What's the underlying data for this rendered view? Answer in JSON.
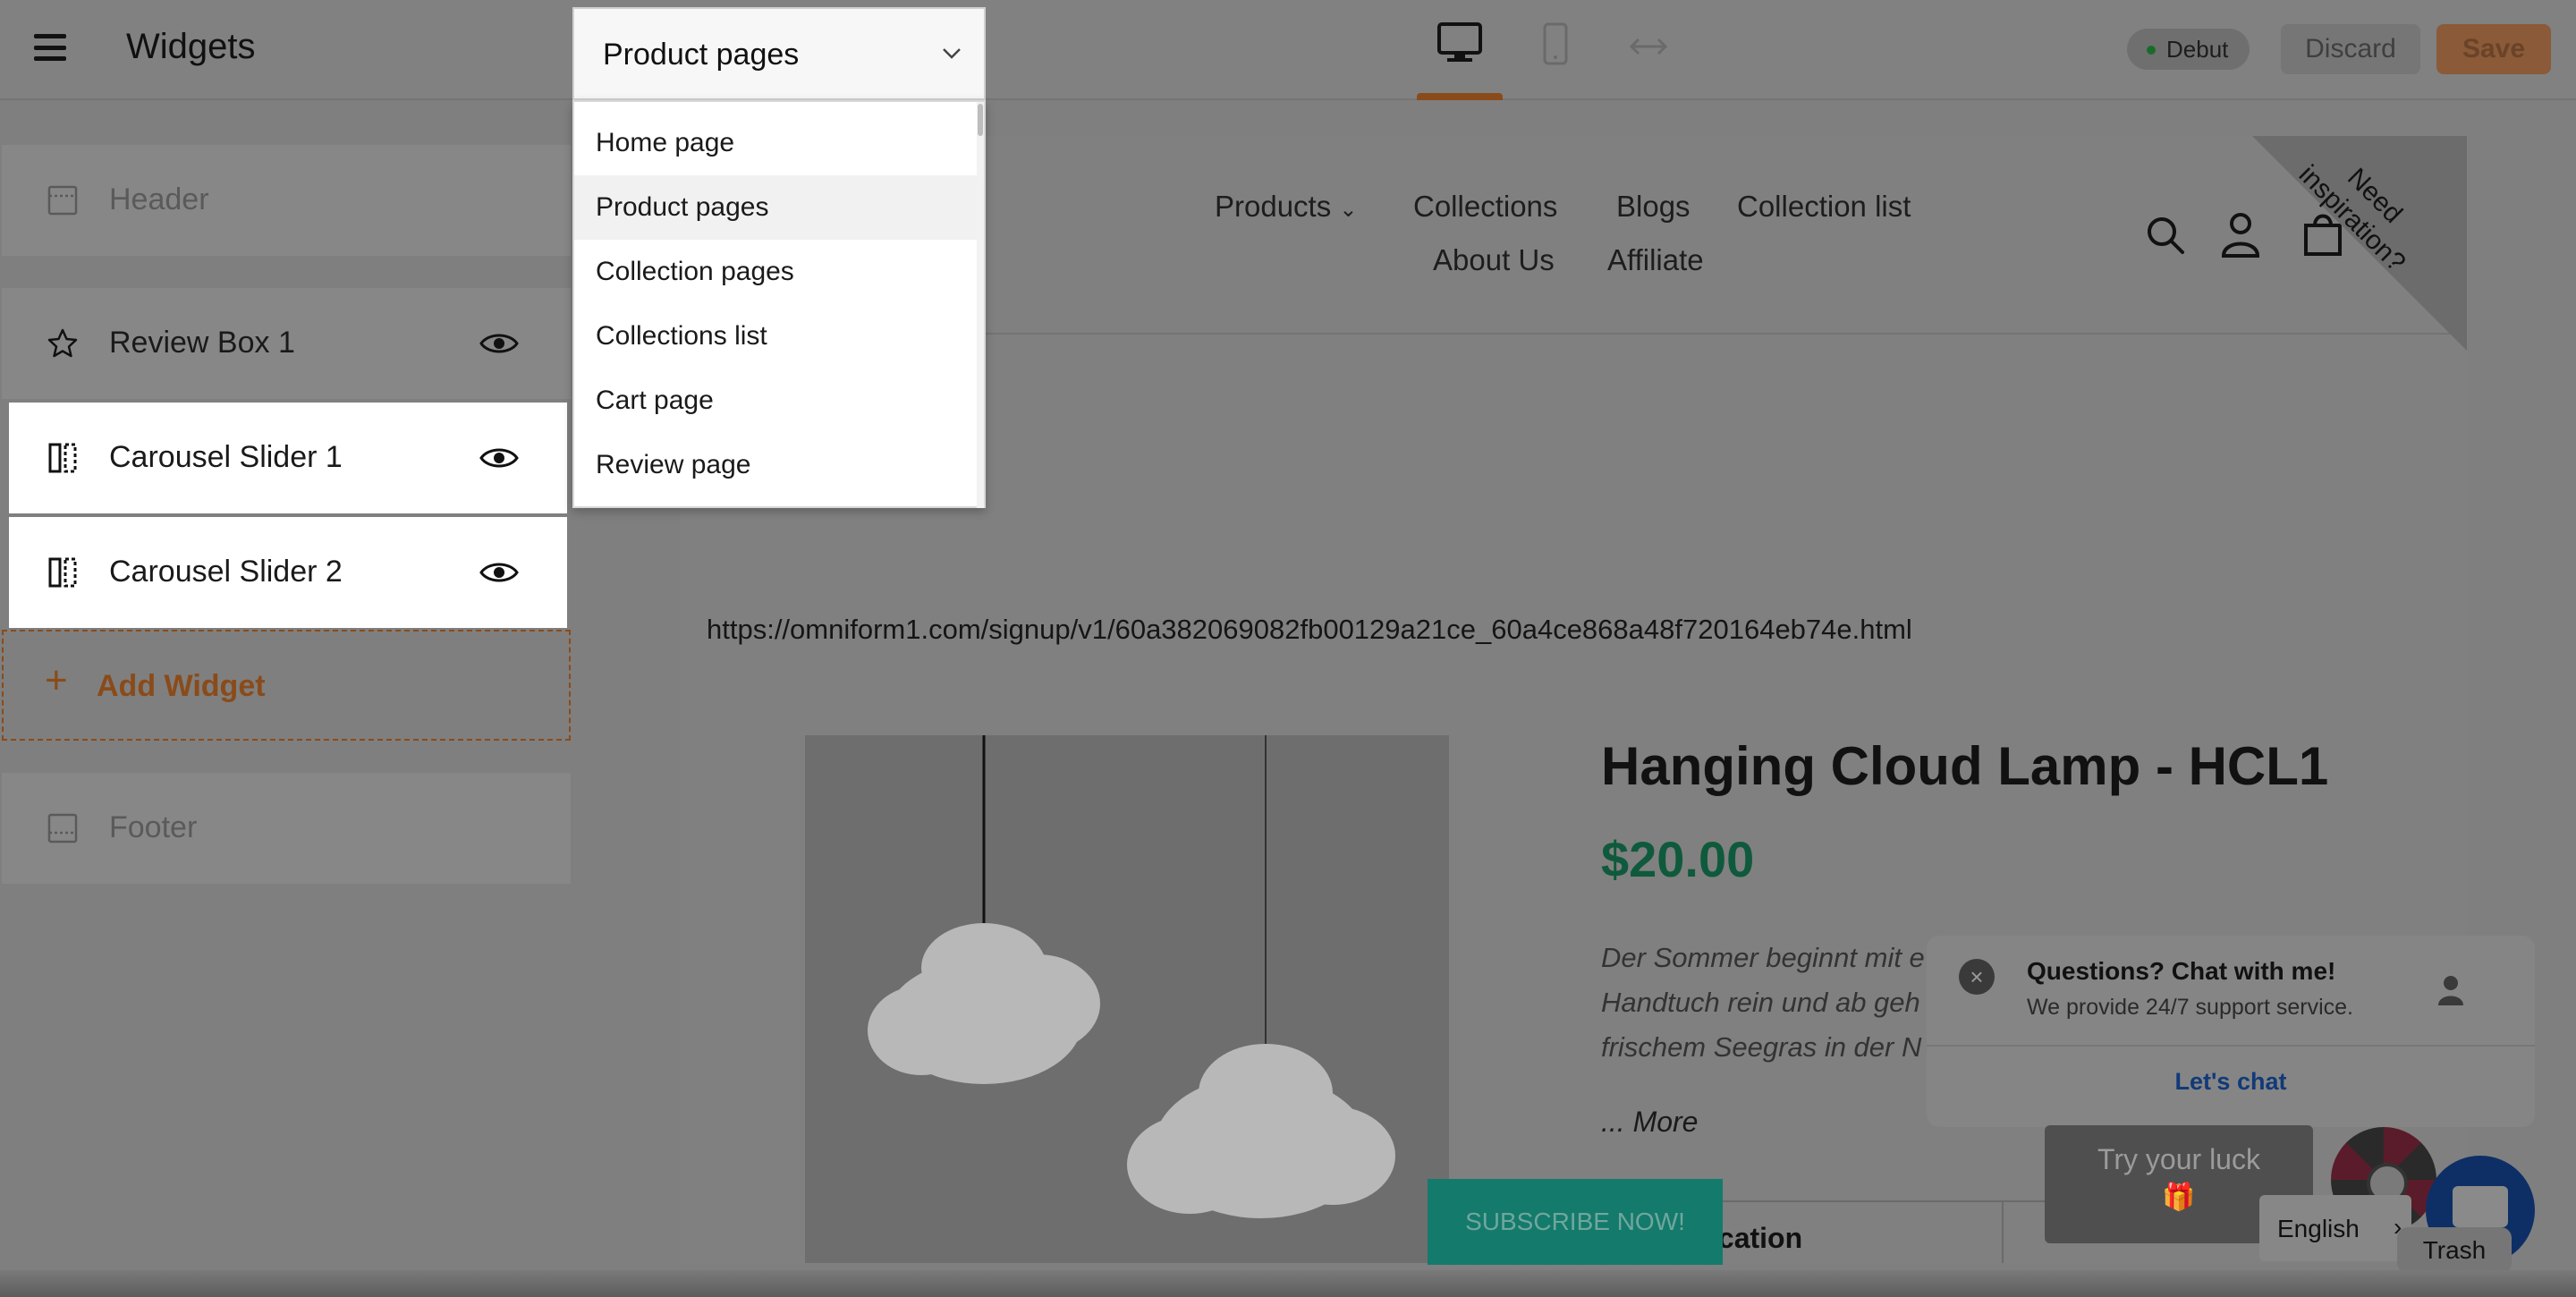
{
  "topbar": {
    "title": "Widgets",
    "theme_badge": "Debut",
    "discard_label": "Discard",
    "save_label": "Save"
  },
  "page_select": {
    "current": "Product pages",
    "options": [
      "Home page",
      "Product pages",
      "Collection pages",
      "Collections list",
      "Cart page",
      "Review page"
    ]
  },
  "sidebar": {
    "header_label": "Header",
    "widgets": [
      {
        "label": "Review Box 1",
        "icon": "star-icon"
      },
      {
        "label": "Carousel Slider 1",
        "icon": "carousel-icon"
      },
      {
        "label": "Carousel Slider 2",
        "icon": "carousel-icon"
      }
    ],
    "add_widget_label": "Add Widget",
    "footer_label": "Footer"
  },
  "preview": {
    "nav": [
      "Products",
      "Collections",
      "Blogs",
      "Collection list",
      "About Us",
      "Affiliate"
    ],
    "ribbon": "Need inspiration?",
    "url": "https://omniform1.com/signup/v1/60a382069082fb00129a21ce_60a4ce868a48f720164eb74e.html",
    "product": {
      "title": "Hanging Cloud Lamp - HCL1",
      "price": "$20.00",
      "description_lines": [
        "Der Sommer beginnt mit e",
        "Handtuch rein und ab geh",
        "frischem Seegras in der N"
      ],
      "more": "... More",
      "spec_label": "ication"
    },
    "subscribe": "SUBSCRIBE NOW!"
  },
  "chat": {
    "title": "Questions? Chat with me!",
    "subtitle": "We provide 24/7 support service.",
    "cta": "Let's chat",
    "close": "×"
  },
  "luck": {
    "text": "Try your luck",
    "gift": "🎁"
  },
  "language": {
    "label": "English"
  },
  "trash_tip": "Trash",
  "colors": {
    "accent": "#8a4b1a",
    "price": "#0f5a3c",
    "subscribe": "#147a6c"
  }
}
